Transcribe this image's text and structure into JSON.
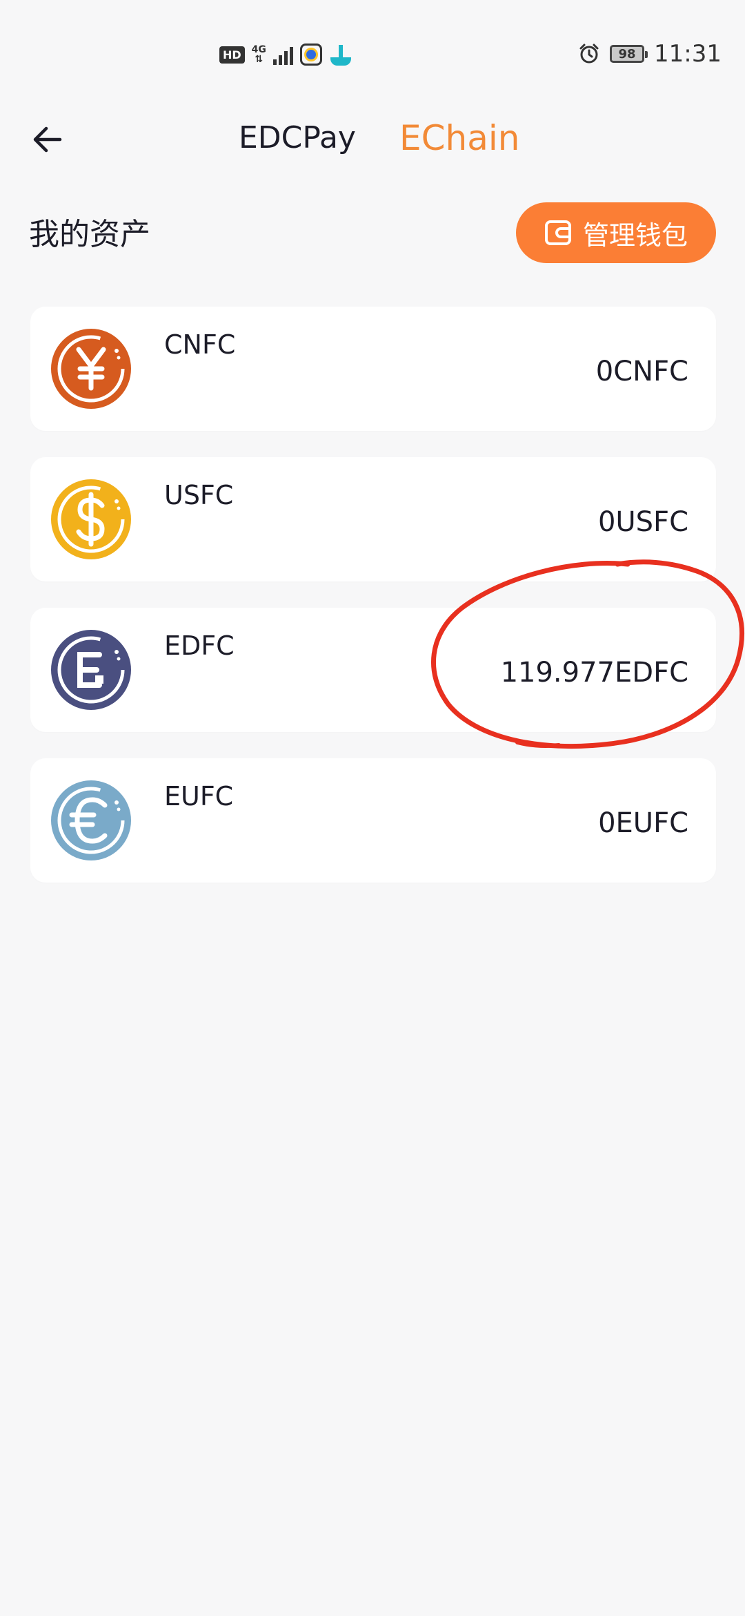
{
  "status_bar": {
    "hd": "HD",
    "net": "4G",
    "battery": "98",
    "time": "11:31"
  },
  "header": {
    "tabs": [
      {
        "label": "EDCPay",
        "active": false
      },
      {
        "label": "EChain",
        "active": true
      }
    ]
  },
  "section": {
    "title": "我的资产",
    "manage_wallet": "管理钱包"
  },
  "assets": [
    {
      "name": "CNFC",
      "balance": "0CNFC",
      "icon": "yuan-coin-icon",
      "color": "#d65b1f"
    },
    {
      "name": "USFC",
      "balance": "0USFC",
      "icon": "dollar-coin-icon",
      "color": "#f2b11b"
    },
    {
      "name": "EDFC",
      "balance": "119.977EDFC",
      "icon": "edfc-coin-icon",
      "color": "#4a4f80"
    },
    {
      "name": "EUFC",
      "balance": "0EUFC",
      "icon": "euro-coin-icon",
      "color": "#7aaac9"
    }
  ],
  "colors": {
    "accent": "#f28a37",
    "button": "#fb7e35",
    "annotation": "#e8301f",
    "background": "#f7f7f8"
  }
}
